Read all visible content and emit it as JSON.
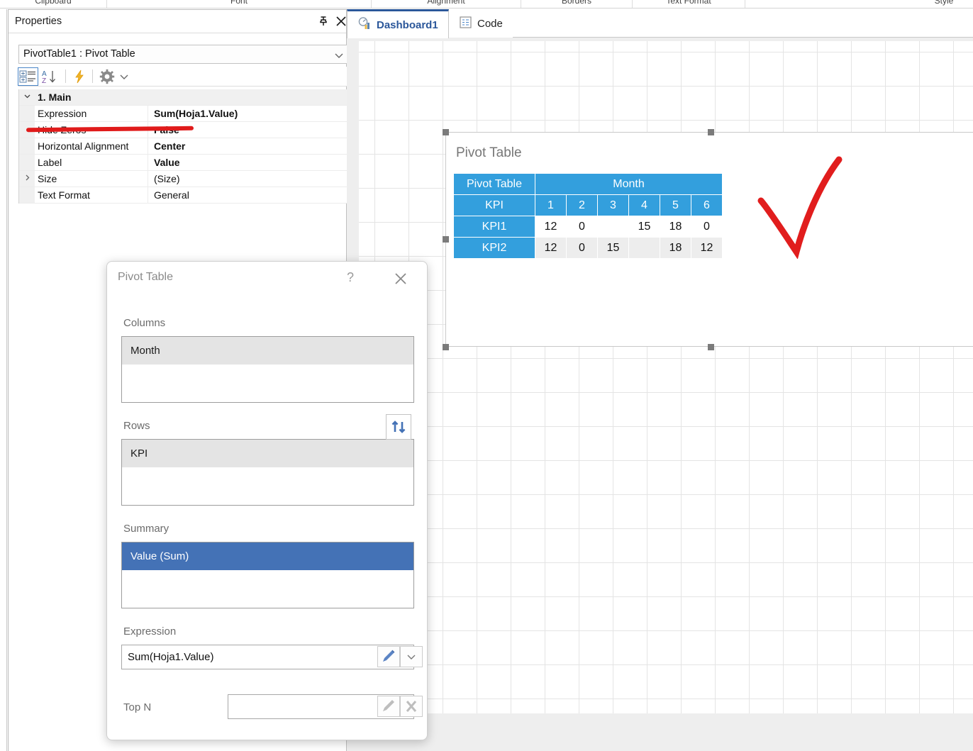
{
  "ribbon": {
    "groups": [
      "Clipboard",
      "Font",
      "Alignment",
      "Borders",
      "Text Format",
      "Style"
    ]
  },
  "properties_panel": {
    "title": "Properties",
    "pin_icon": "pin-icon",
    "close_icon": "close-icon",
    "object_selector": "PivotTable1 : Pivot Table",
    "toolbar": {
      "categorized_icon": "categorized-view-icon",
      "alphabetical_icon": "alphabetical-sort-icon",
      "events_icon": "events-lightning-icon",
      "settings_icon": "gear-icon",
      "settings_dropdown_icon": "chevron-down-icon"
    },
    "category": "1. Main",
    "rows": [
      {
        "name": "Expression",
        "value": "Sum(Hoja1.Value)",
        "bold": true,
        "expandable": false
      },
      {
        "name": "Hide Zeros",
        "value": "False",
        "bold": true,
        "expandable": false
      },
      {
        "name": "Horizontal Alignment",
        "value": "Center",
        "bold": true,
        "expandable": false
      },
      {
        "name": "Label",
        "value": "Value",
        "bold": true,
        "expandable": false
      },
      {
        "name": "Size",
        "value": "(Size)",
        "bold": false,
        "expandable": true
      },
      {
        "name": "Text Format",
        "value": "General",
        "bold": false,
        "expandable": false
      }
    ]
  },
  "annotations": {
    "underline_color": "#e01b1b",
    "check_color": "#e11d1d",
    "underline_target": "Hide Zeros",
    "check_target": "pivot-table-widget"
  },
  "document_tabs": [
    {
      "label": "Dashboard1",
      "icon": "dashboard-chart-icon",
      "active": true
    },
    {
      "label": "Code",
      "icon": "code-document-icon",
      "active": false
    }
  ],
  "widget": {
    "title": "Pivot Table",
    "accent_color": "#339fdd"
  },
  "chart_data": {
    "type": "table",
    "title": "Pivot Table",
    "corner_label": "Pivot Table",
    "column_group_label": "Month",
    "row_group_label": "KPI",
    "categories": [
      "1",
      "2",
      "3",
      "4",
      "5",
      "6"
    ],
    "series": [
      {
        "name": "KPI1",
        "values": [
          "12",
          "0",
          "",
          "15",
          "18",
          "0"
        ]
      },
      {
        "name": "KPI2",
        "values": [
          "12",
          "0",
          "15",
          "",
          "18",
          "12"
        ]
      }
    ]
  },
  "dialog": {
    "title": "Pivot Table",
    "help_label": "?",
    "close_icon": "close-icon",
    "columns": {
      "label": "Columns",
      "items": [
        {
          "label": "Month",
          "selected": false
        }
      ]
    },
    "rows": {
      "label": "Rows",
      "items": [
        {
          "label": "KPI",
          "selected": false
        }
      ],
      "swap_icon": "swap-up-down-icon"
    },
    "summary": {
      "label": "Summary",
      "items": [
        {
          "label": "Value (Sum)",
          "selected": true
        }
      ]
    },
    "expression": {
      "label": "Expression",
      "value": "Sum(Hoja1.Value)",
      "edit_icon": "pencil-icon",
      "dropdown_icon": "chevron-down-icon"
    },
    "top_n": {
      "label": "Top N",
      "value": "",
      "placeholder": "",
      "edit_icon": "pencil-icon",
      "clear_icon": "clear-x-icon"
    }
  }
}
